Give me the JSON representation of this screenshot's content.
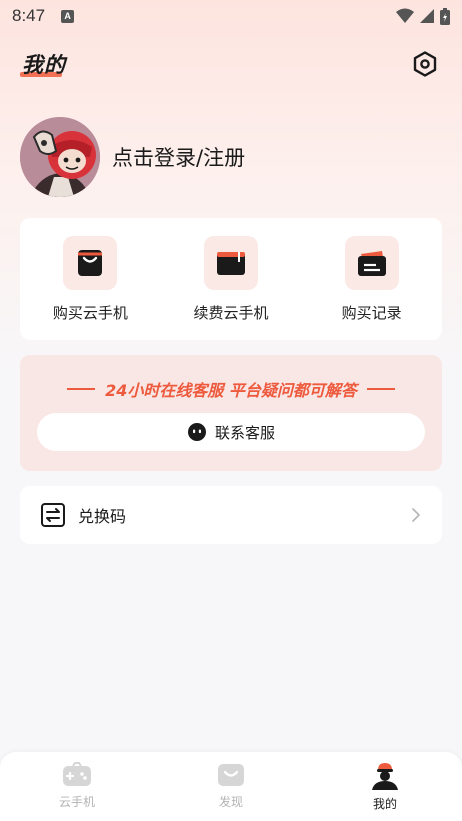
{
  "status_bar": {
    "time": "8:47",
    "badge": "A"
  },
  "header": {
    "title": "我的"
  },
  "profile": {
    "login_label": "点击登录/注册"
  },
  "quick_actions": [
    {
      "label": "购买云手机",
      "icon": "shopping-bag-icon"
    },
    {
      "label": "续费云手机",
      "icon": "renew-box-icon"
    },
    {
      "label": "购买记录",
      "icon": "wallet-record-icon"
    }
  ],
  "service": {
    "banner": "24小时在线客服 平台疑问都可解答",
    "contact_label": "联系客服"
  },
  "redeem": {
    "label": "兑换码"
  },
  "tabbar": {
    "items": [
      {
        "label": "云手机",
        "icon": "gamepad-icon",
        "active": false
      },
      {
        "label": "发现",
        "icon": "discover-icon",
        "active": false
      },
      {
        "label": "我的",
        "icon": "profile-icon",
        "active": true
      }
    ]
  },
  "colors": {
    "accent": "#ee5a3d",
    "icon_bg": "#fbe9e6",
    "service_bg": "#f8e7e5"
  }
}
